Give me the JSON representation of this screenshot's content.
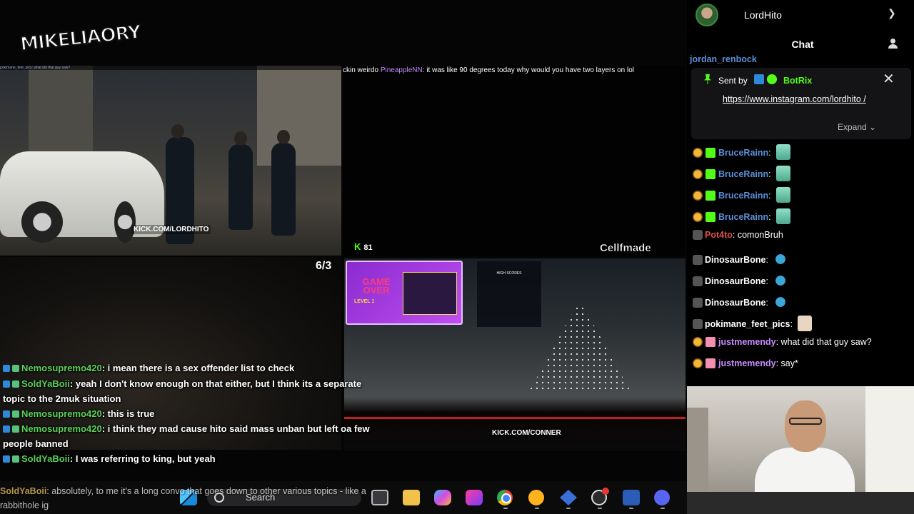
{
  "stream": {
    "logo_text": "MIKELIAORY",
    "top_ticker": {
      "prefix": "ckin weirdo",
      "name": "PineappleNN",
      "message": "it was like 90 degrees today why would you have two layers on lol"
    },
    "mini_ticker": "pokimane_feet_pics: what did that guy saw?",
    "tile_labels": {
      "street_url": "KICK.COM/LORDHITO",
      "drive_url": "KICK.COM/CONNER",
      "viewer_count": "81",
      "watermark": "Cellfmade",
      "tile_count": "6/3"
    },
    "game_over": {
      "title": "GAME OVER",
      "sub": "LEVEL 1"
    },
    "scoreboard_title": "HIGH SCORES"
  },
  "chat_overlay": [
    {
      "name": "Nemosupremo420",
      "text": ": i mean there is a sex offender list to check"
    },
    {
      "name": "SoldYaBoii",
      "text": ": yeah I don't know enough on that either, but I think its a separate topic to the 2muk situation"
    },
    {
      "name": "Nemosupremo420",
      "text": ": this is true"
    },
    {
      "name": "Nemosupremo420",
      "text": ": i think they mad cause hito said mass unban but left oa few people banned"
    },
    {
      "name": "SoldYaBoii",
      "text": ": I was referring to king, but yeah"
    }
  ],
  "bottom_overlay": {
    "name": "SoldYaBoii",
    "text": ": absolutely, to me it's a long convo that goes down to other various topics - like a rabbithole ig"
  },
  "taskbar": {
    "search_placeholder": "Search"
  },
  "sidebar": {
    "username": "LordHito",
    "chat_title": "Chat",
    "cut_off_name": "jordan_renbock",
    "pinned": {
      "sent_by_label": "Sent by",
      "bot_name": "BotRix",
      "link": "https://www.instagram.com/lordhito /",
      "expand_label": "Expand"
    },
    "messages": [
      {
        "name": "BruceRainn",
        "color": "#5b8fd8",
        "text": "",
        "emote": "ghost"
      },
      {
        "name": "BruceRainn",
        "color": "#5b8fd8",
        "text": "",
        "emote": "ghost"
      },
      {
        "name": "BruceRainn",
        "color": "#5b8fd8",
        "text": "",
        "emote": "ghost"
      },
      {
        "name": "BruceRainn",
        "color": "#5b8fd8",
        "text": "",
        "emote": "ghost"
      },
      {
        "name": "Pot4to",
        "color": "#e2504a",
        "text": "comonBruh",
        "emote": ""
      },
      {
        "name": "DinosaurBone",
        "color": "#ffffff",
        "text": "",
        "emote": "bird"
      },
      {
        "name": "DinosaurBone",
        "color": "#ffffff",
        "text": "",
        "emote": "bird"
      },
      {
        "name": "DinosaurBone",
        "color": "#ffffff",
        "text": "",
        "emote": "bird"
      },
      {
        "name": "pokimane_feet_pics",
        "color": "#ffffff",
        "text": "",
        "emote": "cat"
      },
      {
        "name": "justmemendy",
        "color": "#c78cff",
        "text": "what did that guy saw?",
        "emote": ""
      },
      {
        "name": "justmemendy",
        "color": "#c78cff",
        "text": "say*",
        "emote": ""
      }
    ]
  },
  "colors": {
    "kick_green": "#53fc18",
    "background": "#000000",
    "pinned_bg": "#141416"
  }
}
